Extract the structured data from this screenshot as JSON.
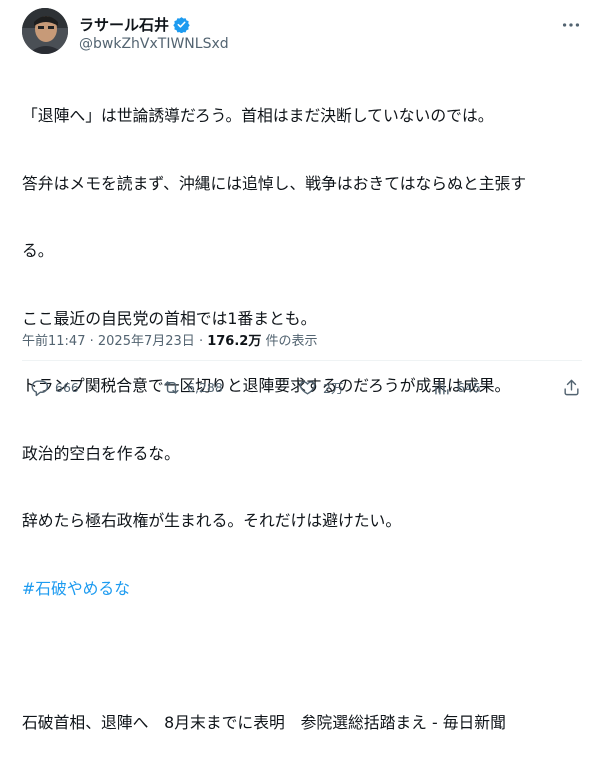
{
  "author": {
    "name": "ラサール石井",
    "handle": "@bwkZhVxTIWNLSxd"
  },
  "body": {
    "lines": [
      "「退陣へ」は世論誘導だろう。首相はまだ決断していないのでは。",
      "答弁はメモを読まず、沖縄には追悼し、戦争はおきてはならぬと主張す",
      "る。",
      "ここ最近の自民党の首相では1番まとも。",
      "トランプ関税合意で一区切りと退陣要求するのだろうが成果は成果。",
      "政治的空白を作るな。",
      "辞めたら極右政権が生まれる。それだけは避けたい。"
    ],
    "hashtag": "#石破やめるな",
    "headline": "石破首相、退陣へ　8月末までに表明　参院選総括踏まえ - 毎日新聞"
  },
  "meta": {
    "time": "午前11:47",
    "sep": "·",
    "date": "2025年7月23日",
    "views_value": "176.2万",
    "views_label": "件の表示"
  },
  "actions": {
    "replies": "666",
    "reposts": "6,288",
    "likes": "2万",
    "bookmarks": "645"
  },
  "colors": {
    "accent": "#1d9bf0",
    "muted": "#536471",
    "text": "#0f1419"
  },
  "icons": [
    "verified-badge-icon",
    "more-icon",
    "reply-icon",
    "repost-icon",
    "like-icon",
    "views-chart-icon",
    "share-icon"
  ]
}
